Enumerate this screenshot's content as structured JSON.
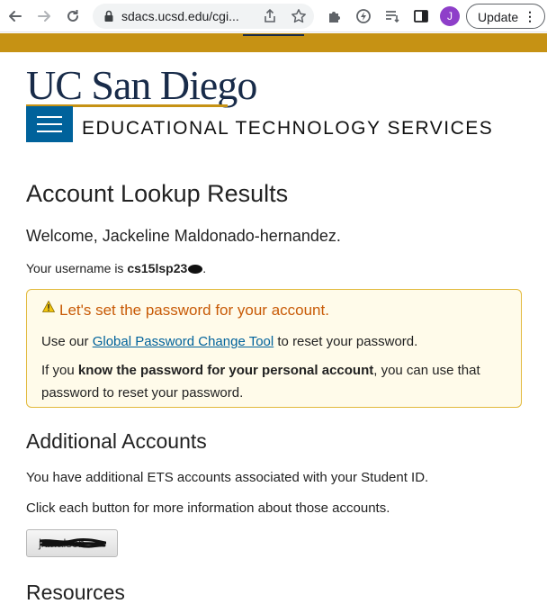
{
  "browser": {
    "url": "sdacs.ucsd.edu/cgi...",
    "avatar_letter": "J",
    "update_label": "Update",
    "menu_dots": "⋮"
  },
  "header": {
    "logo_text": "UC San Diego",
    "department": "EDUCATIONAL TECHNOLOGY SERVICES"
  },
  "main": {
    "title": "Account Lookup Results",
    "welcome": "Welcome, Jackeline Maldonado-hernandez.",
    "username_prefix": "Your username is ",
    "username_value": "cs15lsp23",
    "username_suffix": "."
  },
  "alert": {
    "title": "Let's set the password for your account.",
    "line1_prefix": "Use our ",
    "line1_link": "Global Password Change Tool",
    "line1_suffix": " to reset your password.",
    "line2_prefix": "If you ",
    "line2_bold": "know the password for your personal account",
    "line2_suffix": ", you can use that password to reset your password."
  },
  "additional": {
    "heading": "Additional Accounts",
    "text1": "You have additional ETS accounts associated with your Student ID.",
    "text2": "Click each button for more information about those accounts.",
    "account_button_label": "jxmalson"
  },
  "resources": {
    "heading": "Resources"
  },
  "colors": {
    "gold": "#c69214",
    "navy": "#182b49",
    "blue": "#00629b",
    "alert_title": "#c85a06"
  }
}
